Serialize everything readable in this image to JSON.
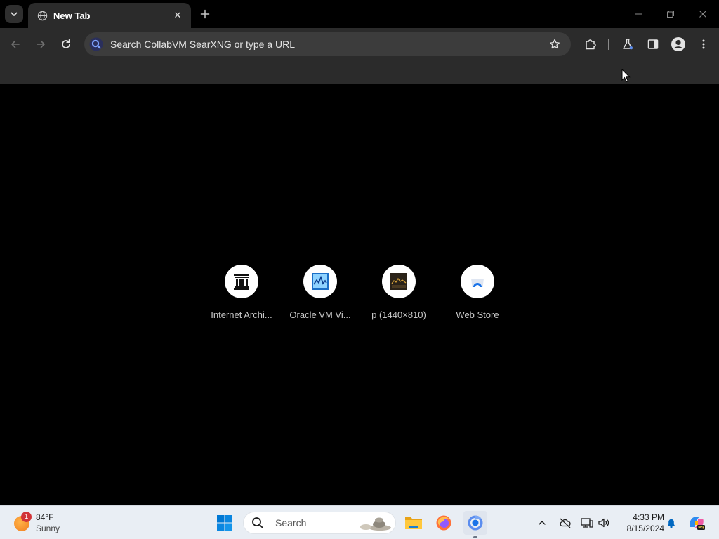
{
  "browser": {
    "tab": {
      "title": "New Tab",
      "close_symbol": "✕"
    },
    "new_tab_symbol": "+",
    "omnibox": {
      "placeholder": "Search CollabVM SearXNG or type a URL"
    }
  },
  "shortcuts": [
    {
      "label": "Internet Archi...",
      "icon": "internet-archive-icon"
    },
    {
      "label": "Oracle VM Vi...",
      "icon": "virtualbox-icon"
    },
    {
      "label": "p (1440×810)",
      "icon": "image-thumbnail-icon"
    },
    {
      "label": "Web Store",
      "icon": "web-store-icon"
    }
  ],
  "taskbar": {
    "weather": {
      "temp": "84°F",
      "condition": "Sunny",
      "badge": "1"
    },
    "search_label": "Search",
    "clock": {
      "time": "4:33 PM",
      "date": "8/15/2024"
    }
  },
  "colors": {
    "accent": "#0067c0",
    "frame": "#000000",
    "toolbar": "#2b2b2b",
    "omnibox": "#3c3c3c",
    "taskbar": "#e9eef4"
  }
}
